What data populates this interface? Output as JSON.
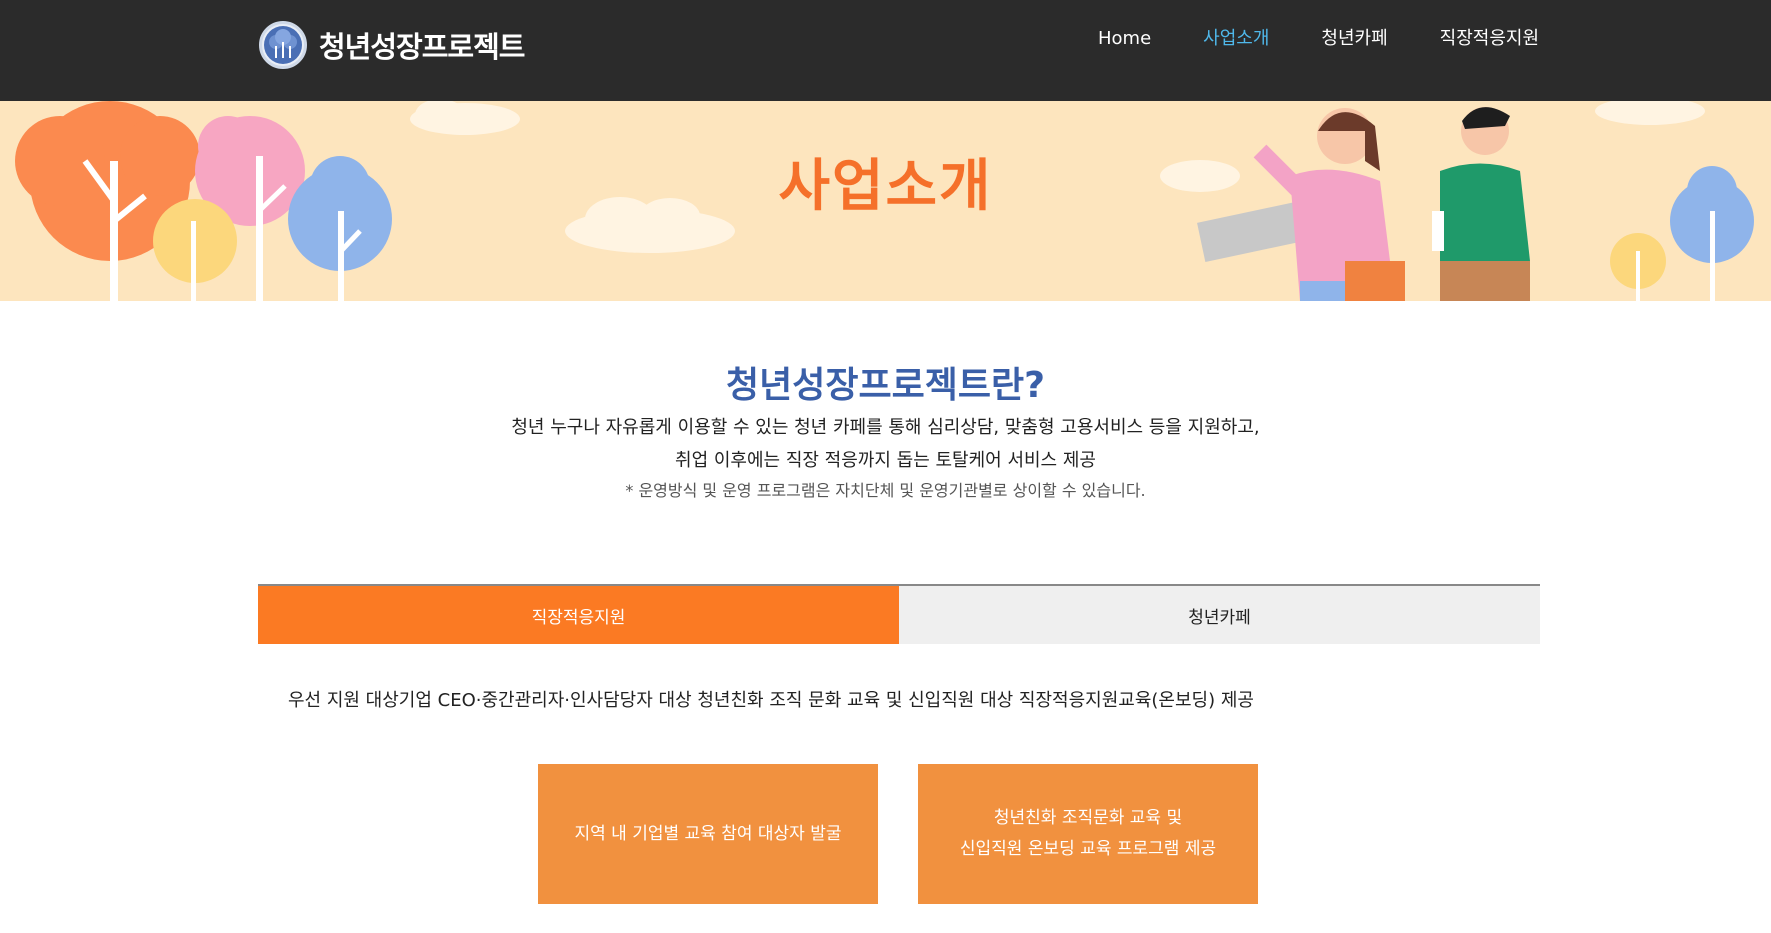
{
  "header": {
    "logo_text": "청년성장프로젝트",
    "nav": [
      {
        "label": "Home",
        "active": false
      },
      {
        "label": "사업소개",
        "active": true
      },
      {
        "label": "청년카페",
        "active": false
      },
      {
        "label": "직장적응지원",
        "active": false
      }
    ]
  },
  "banner": {
    "title": "사업소개"
  },
  "intro": {
    "title": "청년성장프로젝트란?",
    "line1": "청년 누구나 자유롭게 이용할 수 있는 청년 카페를 통해 심리상담, 맞춤형 고용서비스 등을 지원하고,",
    "line2": "취업 이후에는 직장 적응까지 돕는 토탈케어 서비스 제공",
    "note": "* 운영방식 및 운영 프로그램은 자치단체 및 운영기관별로 상이할 수 있습니다."
  },
  "tabs": [
    {
      "label": "직장적응지원",
      "active": true
    },
    {
      "label": "청년카페",
      "active": false
    }
  ],
  "content": {
    "description": "우선 지원 대상기업 CEO·중간관리자·인사담당자 대상 청년친화 조직 문화 교육 및 신입직원 대상 직장적응지원교육(온보딩) 제공",
    "cards": [
      {
        "lines": [
          "지역 내 기업별 교육 참여 대상자 발굴"
        ]
      },
      {
        "lines": [
          "청년친화 조직문화 교육 및",
          "신입직원 온보딩 교육 프로그램 제공"
        ]
      }
    ]
  },
  "colors": {
    "header_bg": "#2b2b2b",
    "nav_active": "#4fb8ea",
    "banner_bg": "#fde5be",
    "banner_title": "#f5702a",
    "intro_title": "#3a5fa8",
    "tab_active": "#fb7a23",
    "card_bg": "#f1913f"
  }
}
